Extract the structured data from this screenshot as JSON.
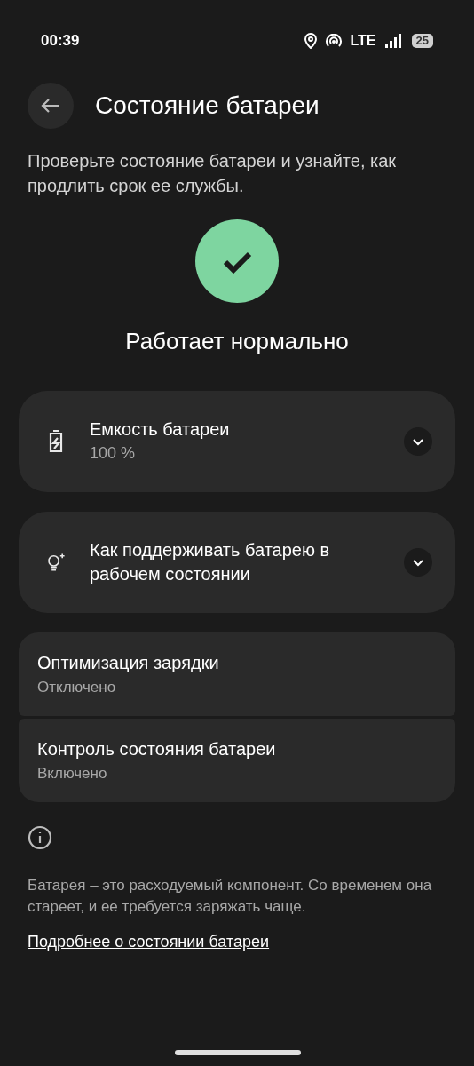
{
  "status_bar": {
    "time": "00:39",
    "network": "LTE",
    "battery": "25"
  },
  "header": {
    "title": "Состояние батареи"
  },
  "description": "Проверьте состояние батареи и узнайте, как продлить срок ее службы.",
  "status": {
    "text": "Работает нормально"
  },
  "expandables": [
    {
      "kind": "battery",
      "title": "Емкость батареи",
      "subtitle": "100 %",
      "expanded": false
    },
    {
      "kind": "tips",
      "title": "Как поддерживать батарею в рабочем состоянии",
      "expanded": false
    }
  ],
  "settings": [
    {
      "title": "Оптимизация зарядки",
      "value": "Отключено"
    },
    {
      "title": "Контроль состояния батареи",
      "value": "Включено"
    }
  ],
  "footer": {
    "text": "Батарея – это расходуемый компонент. Со временем она стареет, и ее требуется заряжать чаще.",
    "link": "Подробнее о состоянии батареи"
  }
}
